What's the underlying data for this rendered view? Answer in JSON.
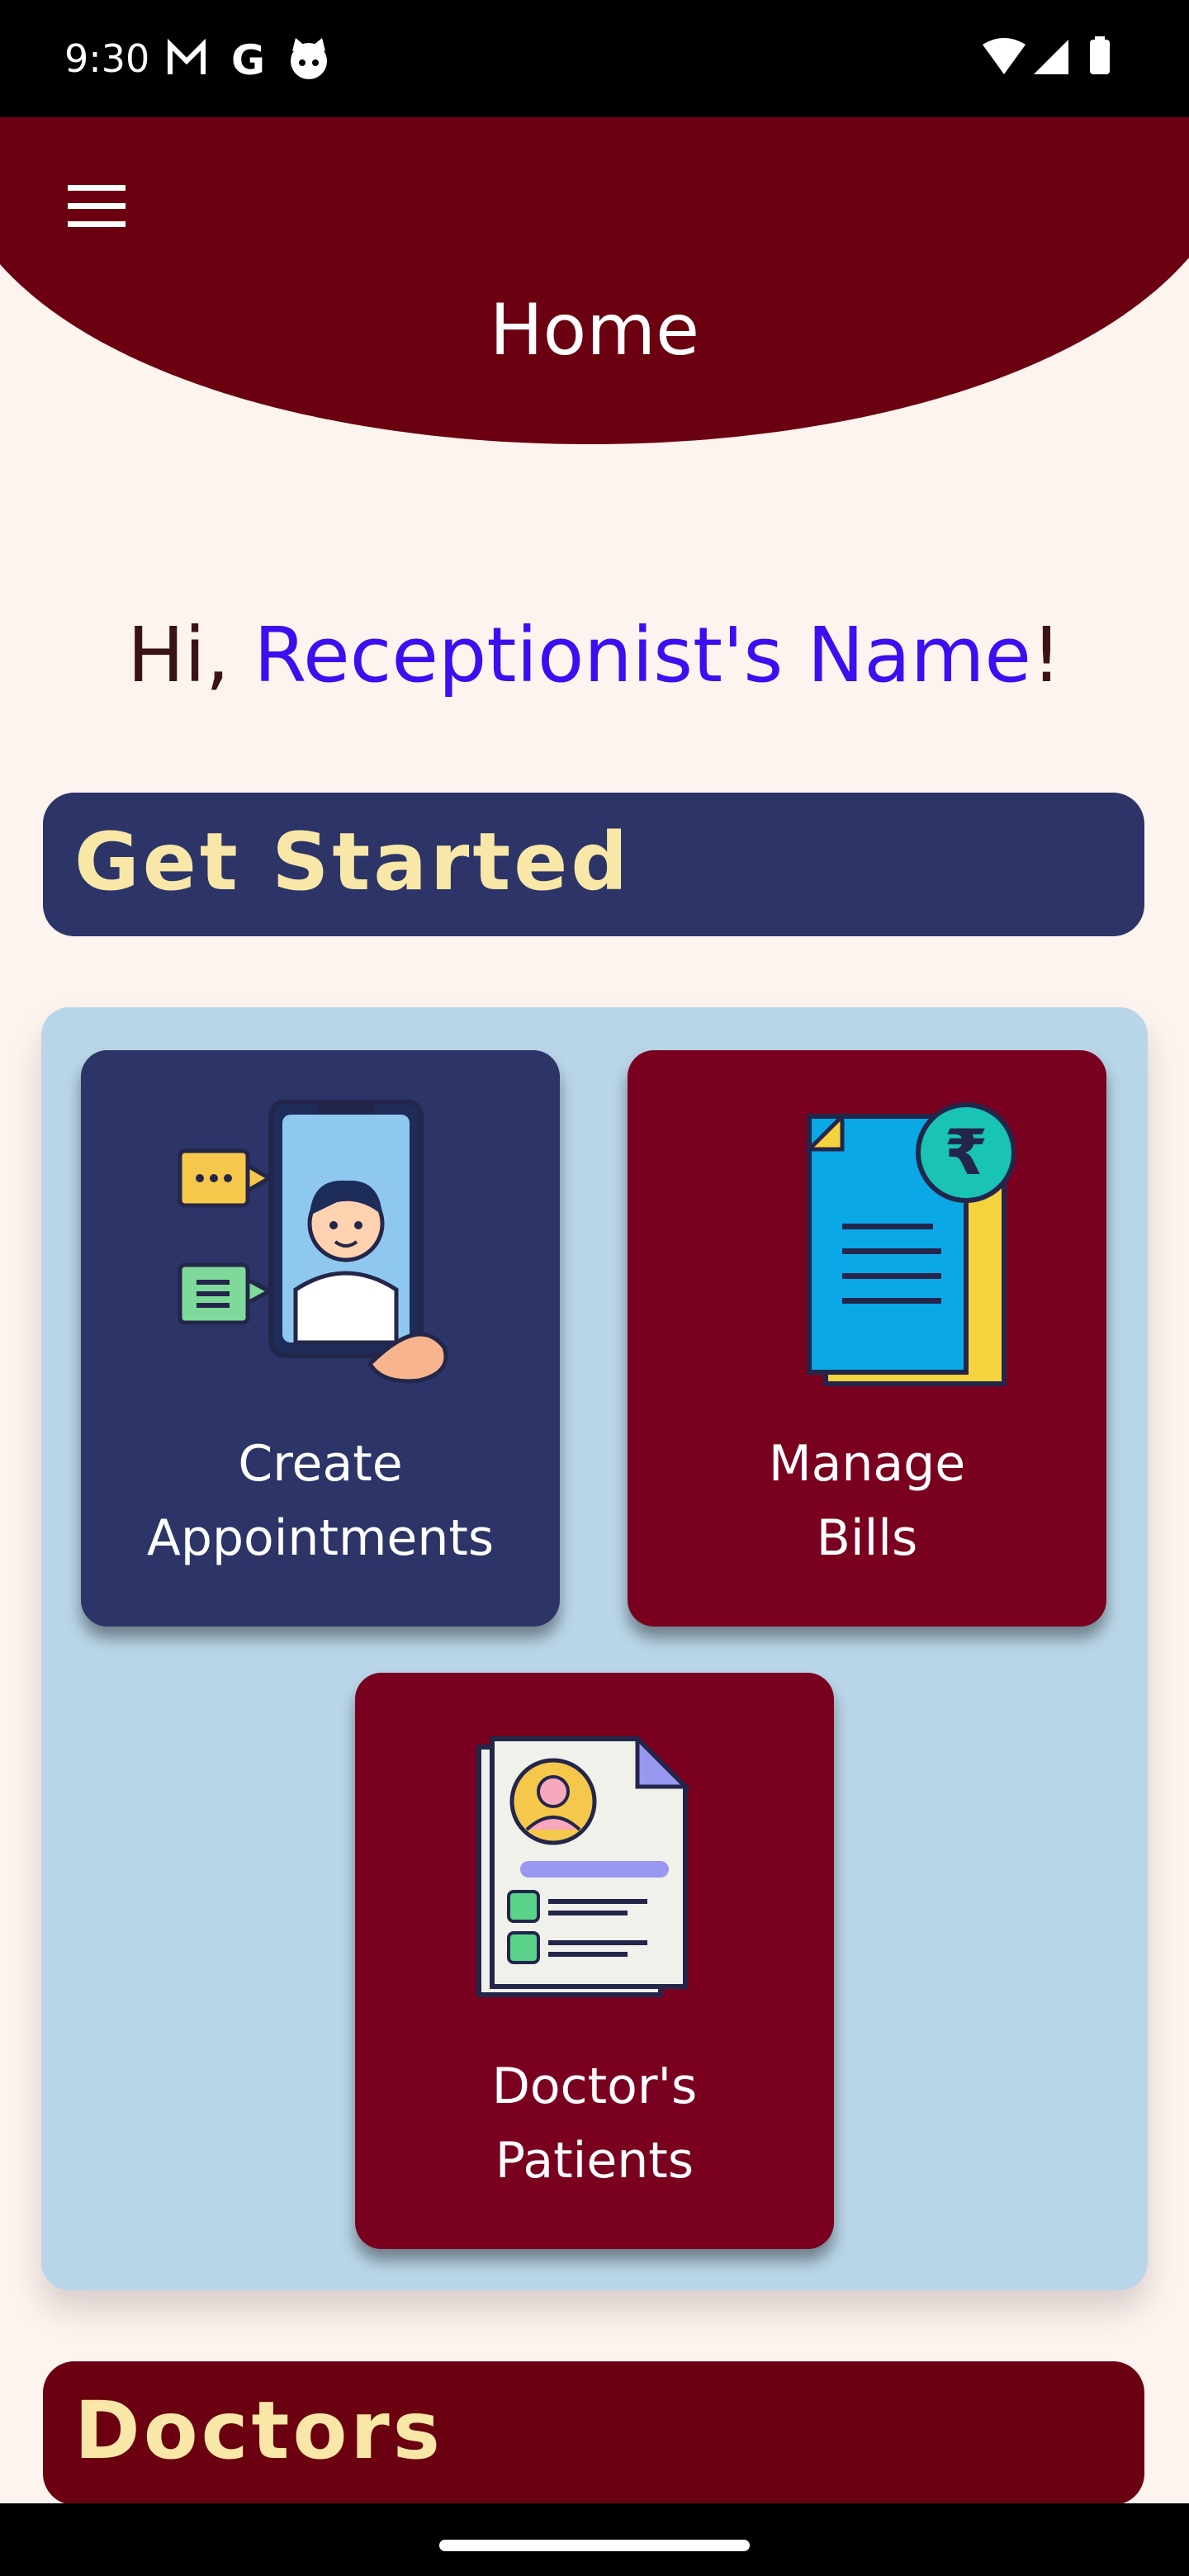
{
  "status_bar": {
    "time": "9:30",
    "icons_left": [
      "gmail-icon",
      "google-icon",
      "cat-icon"
    ],
    "icons_right": [
      "wifi-icon",
      "signal-icon",
      "battery-icon"
    ]
  },
  "header": {
    "title": "Home",
    "menu_icon": "hamburger-menu-icon",
    "color": "#6a0010"
  },
  "greeting": {
    "prefix": "Hi, ",
    "name": "Receptionist's Name",
    "suffix": "!"
  },
  "sections": {
    "get_started": "Get Started",
    "doctors": "Doctors"
  },
  "tiles": [
    {
      "label": "Create\nAppointments",
      "icon": "doctor-phone-icon"
    },
    {
      "label": "Manage\nBills",
      "icon": "rupee-bill-icon"
    },
    {
      "label": "Doctor's\nPatients",
      "icon": "patient-record-icon"
    }
  ],
  "colors": {
    "navy": "#2c3468",
    "maroon": "#7a0020",
    "panel": "#b9d6e8",
    "accent_name": "#3a0ff0",
    "banner_text": "#f8e7a6"
  }
}
